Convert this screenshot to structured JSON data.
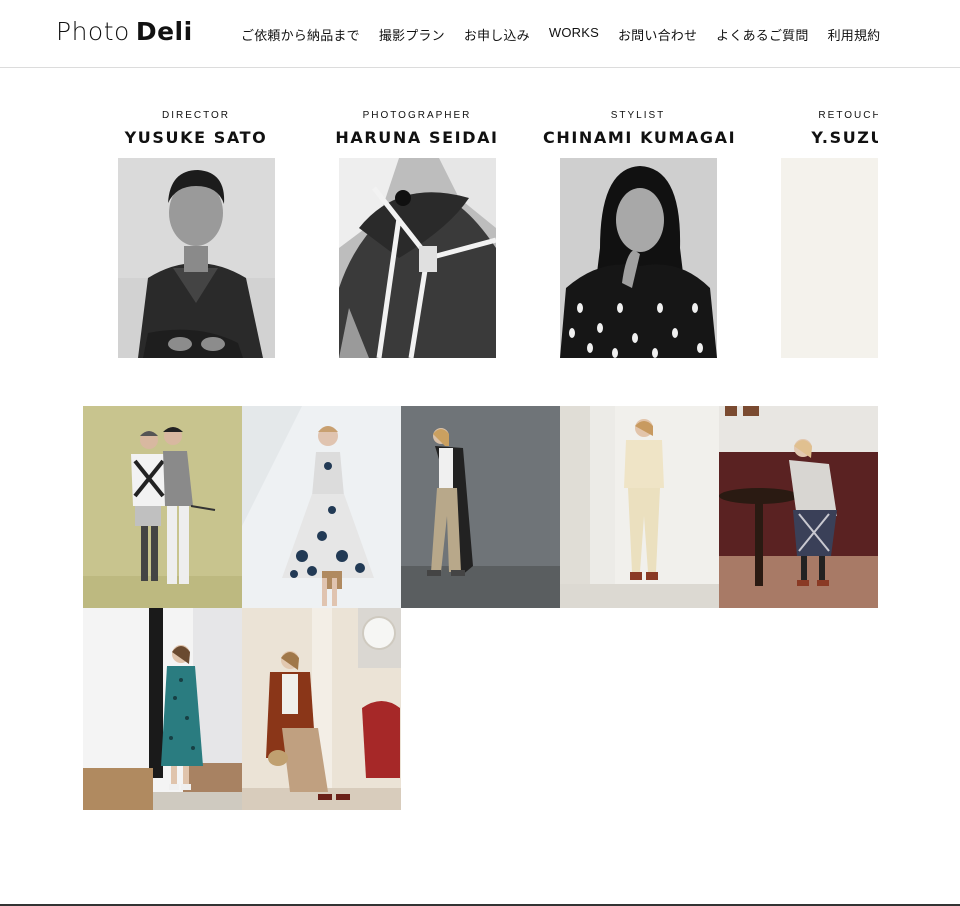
{
  "header": {
    "logo_part1": "Photo",
    "logo_part2": "Deli",
    "nav": [
      {
        "label": "ご依頼から納品まで"
      },
      {
        "label": "撮影プラン"
      },
      {
        "label": "お申し込み"
      },
      {
        "label": "WORKS"
      },
      {
        "label": "お問い合わせ"
      },
      {
        "label": "よくあるご質問"
      },
      {
        "label": "利用規約"
      }
    ]
  },
  "staff": [
    {
      "role": "DIRECTOR",
      "name": "YUSUKE SATO"
    },
    {
      "role": "PHOTOGRAPHER",
      "name": "HARUNA SEIDAI"
    },
    {
      "role": "STYLIST",
      "name": "CHINAMI KUMAGAI"
    },
    {
      "role": "RETOUCHER",
      "name": "Y.SUZUKI"
    }
  ],
  "colors": {
    "background": "#ffffff",
    "text": "#111111",
    "divider": "#dcdcdc",
    "placeholder_photo": "#f4f2ec"
  }
}
